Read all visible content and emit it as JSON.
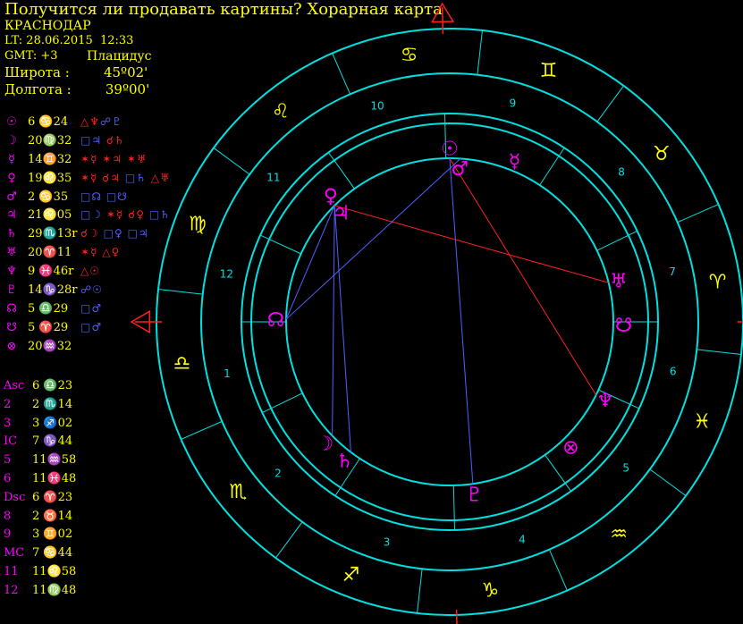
{
  "header": {
    "title": "Получится ли продавать картины? Хорарная карта",
    "city": "КРАСНОДАР",
    "local_time": "LT: 28.06.2015  12:33",
    "gmt": "GMT: +3",
    "house_system": "Плацидус",
    "latitude": "Широта :        45º02'",
    "longitude": "Долгота :        39º00'"
  },
  "planets": [
    {
      "glyph": "☉",
      "pos": "6 ♋24",
      "aspects": [
        {
          "t": "△♆",
          "c": "#ff2020"
        },
        {
          "t": "☍♇",
          "c": "#5060ff"
        }
      ]
    },
    {
      "glyph": "☽",
      "pos": "20♍32",
      "aspects": [
        {
          "t": "□♃",
          "c": "#5060ff"
        },
        {
          "t": " ☌♄",
          "c": "#ff2020"
        }
      ]
    },
    {
      "glyph": "☿",
      "pos": "14♊32",
      "aspects": [
        {
          "t": "✶☿",
          "c": "#ff2020"
        },
        {
          "t": " ✶♃",
          "c": "#ff2020"
        },
        {
          "t": " ✶♅",
          "c": "#ff2020"
        }
      ]
    },
    {
      "glyph": "♀",
      "pos": "19♌35",
      "aspects": [
        {
          "t": "✶☿",
          "c": "#ff2020"
        },
        {
          "t": " ☌♃",
          "c": "#ff2020"
        },
        {
          "t": " □♄",
          "c": "#5060ff"
        },
        {
          "t": " △♅",
          "c": "#ff2020"
        }
      ]
    },
    {
      "glyph": "♂",
      "pos": "2 ♋35",
      "aspects": [
        {
          "t": "□☊",
          "c": "#5060ff"
        },
        {
          "t": " □☋",
          "c": "#5060ff"
        }
      ]
    },
    {
      "glyph": "♃",
      "pos": "21♌05",
      "aspects": [
        {
          "t": "□☽",
          "c": "#5060ff"
        },
        {
          "t": " ✶☿",
          "c": "#ff2020"
        },
        {
          "t": " ☌♀",
          "c": "#ff2020"
        },
        {
          "t": " □♄",
          "c": "#5060ff"
        }
      ]
    },
    {
      "glyph": "♄",
      "pos": "29♏13r",
      "aspects": [
        {
          "t": "☌☽",
          "c": "#ff2020"
        },
        {
          "t": " □♀",
          "c": "#5060ff"
        },
        {
          "t": " □♃",
          "c": "#5060ff"
        }
      ]
    },
    {
      "glyph": "♅",
      "pos": "20♈11",
      "aspects": [
        {
          "t": "✶☿",
          "c": "#ff2020"
        },
        {
          "t": " △♀",
          "c": "#ff2020"
        }
      ]
    },
    {
      "glyph": "♆",
      "pos": "9 ♓46r",
      "aspects": [
        {
          "t": "△☉",
          "c": "#ff2020"
        }
      ]
    },
    {
      "glyph": "♇",
      "pos": "14♑28r",
      "aspects": [
        {
          "t": "☍☉",
          "c": "#5060ff"
        }
      ]
    },
    {
      "glyph": "☊",
      "pos": "5 ♎29",
      "aspects": [
        {
          "t": "□♂",
          "c": "#5060ff"
        }
      ]
    },
    {
      "glyph": "☋",
      "pos": "5 ♈29",
      "aspects": [
        {
          "t": "□♂",
          "c": "#5060ff"
        }
      ]
    },
    {
      "glyph": "⊗",
      "pos": "20♒32",
      "aspects": []
    }
  ],
  "cusps": [
    {
      "label": "Asc",
      "pos": "6 ♎23"
    },
    {
      "label": "2",
      "pos": "2 ♏14"
    },
    {
      "label": "3",
      "pos": "3 ♐02"
    },
    {
      "label": "IC",
      "pos": "7 ♑44"
    },
    {
      "label": "5",
      "pos": "11♒58"
    },
    {
      "label": "6",
      "pos": "11♓48"
    },
    {
      "label": "Dsc",
      "pos": "6 ♈23"
    },
    {
      "label": "8",
      "pos": "2 ♉14"
    },
    {
      "label": "9",
      "pos": "3 ♊02"
    },
    {
      "label": "MC",
      "pos": "7 ♋44"
    },
    {
      "label": "11",
      "pos": "11♌58"
    },
    {
      "label": "12",
      "pos": "11♍48"
    }
  ],
  "wheel": {
    "asc_longitude": 186.38,
    "cusp_longitudes": [
      186.38,
      212.23,
      243.03,
      277.73,
      311.97,
      341.8,
      6.38,
      32.23,
      63.03,
      97.73,
      131.97,
      161.8
    ],
    "house_numbers": [
      "1",
      "2",
      "3",
      "4",
      "5",
      "6",
      "7",
      "8",
      "9",
      "10",
      "11",
      "12"
    ],
    "sign_glyphs": [
      "♈",
      "♉",
      "♊",
      "♋",
      "♌",
      "♍",
      "♎",
      "♏",
      "♐",
      "♑",
      "♒",
      "♓"
    ],
    "planets": [
      {
        "name": "sun",
        "glyph": "☉",
        "lon": 96.4
      },
      {
        "name": "moon",
        "glyph": "☽",
        "lon": 230.5
      },
      {
        "name": "mercury",
        "glyph": "☿",
        "lon": 74.5
      },
      {
        "name": "venus",
        "glyph": "♀",
        "lon": 139.6
      },
      {
        "name": "mars",
        "glyph": "♂",
        "lon": 92.6
      },
      {
        "name": "jupiter",
        "glyph": "♃",
        "lon": 141.1
      },
      {
        "name": "saturn",
        "glyph": "♄",
        "lon": 239.2
      },
      {
        "name": "uranus",
        "glyph": "♅",
        "lon": 20.2
      },
      {
        "name": "neptune",
        "glyph": "♆",
        "lon": 339.8
      },
      {
        "name": "pluto",
        "glyph": "♇",
        "lon": 284.5
      },
      {
        "name": "north-node",
        "glyph": "☊",
        "lon": 185.5
      },
      {
        "name": "south-node",
        "glyph": "☋",
        "lon": 5.5
      },
      {
        "name": "fortune",
        "glyph": "⊗",
        "lon": 320.5
      }
    ],
    "aspects": [
      {
        "from": 96.4,
        "to": 339.8,
        "color": "#ff2020"
      },
      {
        "from": 96.4,
        "to": 284.5,
        "color": "#5060ff"
      },
      {
        "from": 141.1,
        "to": 20.2,
        "color": "#ff2020"
      },
      {
        "from": 141.1,
        "to": 239.2,
        "color": "#5060ff"
      },
      {
        "from": 141.1,
        "to": 230.5,
        "color": "#5060ff"
      },
      {
        "from": 141.1,
        "to": 185.5,
        "color": "#5060ff"
      },
      {
        "from": 92.6,
        "to": 185.5,
        "color": "#5060ff"
      }
    ]
  },
  "colors": {
    "ring": "#00e0e0",
    "signs": "#ffff00",
    "planets": "#ff00ff",
    "axis": "#ff2020",
    "text": "#ffff00"
  }
}
